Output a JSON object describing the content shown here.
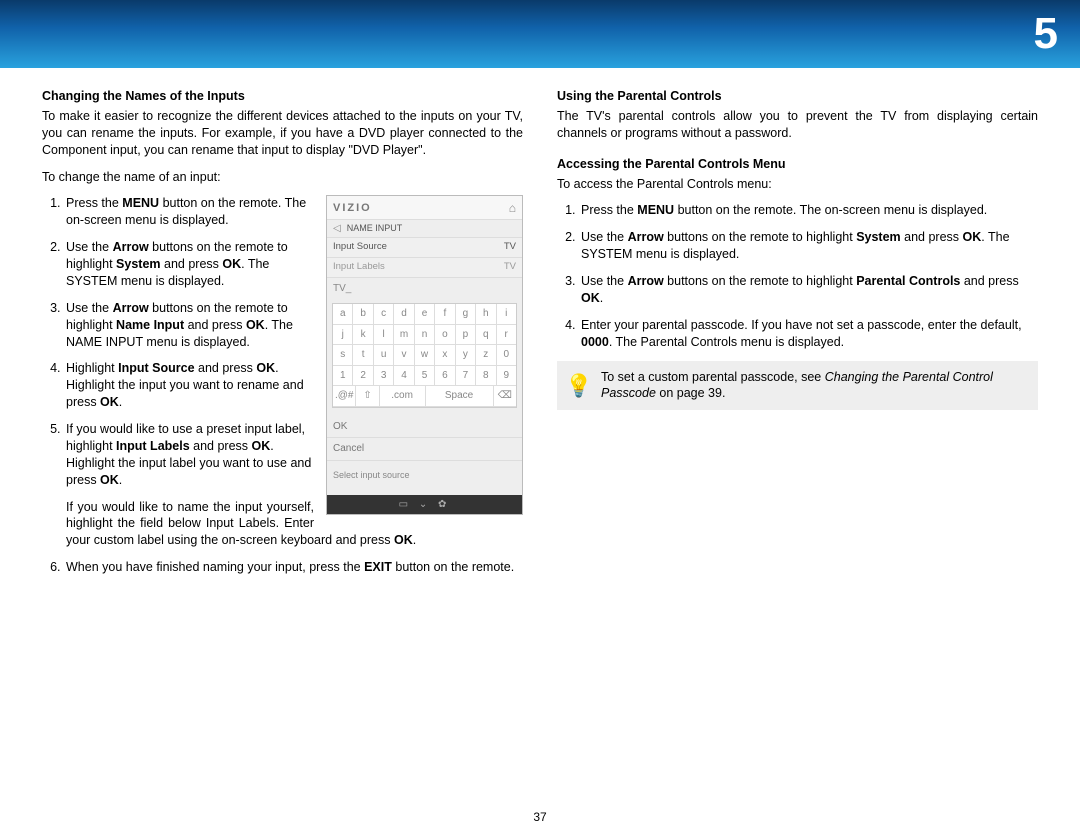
{
  "chapter": "5",
  "page_number": "37",
  "left": {
    "title": "Changing the Names of the Inputs",
    "intro": "To make it easier to recognize the different devices attached to the inputs on your TV, you can rename the inputs. For example, if you have a DVD player connected to the Component input, you can rename that input to display \"DVD Player\".",
    "lead": "To change the name of an input:",
    "steps_html": [
      "Press the <b>MENU</b> button on the remote. The on-screen menu is displayed.",
      "Use the <b>Arrow</b> buttons on the remote to highlight <b>System</b> and press <b>OK</b>. The SYSTEM menu is displayed.",
      "Use the <b>Arrow</b> buttons on the remote to highlight <b>Name Input</b> and press <b>OK</b>. The NAME INPUT menu is displayed.",
      "Highlight <b>Input Source</b> and press <b>OK</b>. Highlight the input you want to rename and press <b>OK</b>.",
      "If you would like to use a preset input label, highlight <b>Input Labels</b> and press <b>OK</b>. Highlight the input label you want to use and press <b>OK</b>.<div class=\"para justify\" style=\"margin:10px 0 0 0;\">If you would like to name the input yourself, highlight the field below Input Labels. Enter your custom label using the on-screen keyboard and press <b>OK</b>.</div>",
      "When you have finished naming your input, press the <b>EXIT</b> button on the remote."
    ],
    "osd": {
      "brand": "VIZIO",
      "subtitle": "NAME INPUT",
      "rows": [
        {
          "label": "Input Source",
          "value": "TV"
        },
        {
          "label": "Input Labels",
          "value": "TV"
        }
      ],
      "field_value": "TV_",
      "kbd_rows": [
        [
          "a",
          "b",
          "c",
          "d",
          "e",
          "f",
          "g",
          "h",
          "i"
        ],
        [
          "j",
          "k",
          "l",
          "m",
          "n",
          "o",
          "p",
          "q",
          "r"
        ],
        [
          "s",
          "t",
          "u",
          "v",
          "w",
          "x",
          "y",
          "z",
          "0"
        ],
        [
          "1",
          "2",
          "3",
          "4",
          "5",
          "6",
          "7",
          "8",
          "9"
        ]
      ],
      "kbd_bottom": [
        ".@#",
        "⇧",
        ".com",
        "Space",
        "⌫"
      ],
      "actions": [
        "OK",
        "Cancel"
      ],
      "hint": "Select input source",
      "footer_icons": "▭  ⌄  ✿"
    }
  },
  "right": {
    "title1": "Using the Parental Controls",
    "para1": "The TV's parental controls allow you to prevent the TV from displaying certain channels or programs without a password.",
    "title2": "Accessing the Parental Controls Menu",
    "lead2": "To access the Parental Controls menu:",
    "steps_html": [
      "Press the <b>MENU</b> button on the remote. The on-screen menu is displayed.",
      "Use the <b>Arrow</b> buttons on the remote to highlight <b>System</b> and press <b>OK</b>. The SYSTEM menu is displayed.",
      "Use the <b>Arrow</b> buttons on the remote to highlight <b>Parental Controls</b> and press <b>OK</b>.",
      "Enter your parental passcode. If you have not set a passcode, enter the default, <b>0000</b>. The Parental Controls menu is displayed."
    ],
    "tip_lead": "To set a custom parental passcode, see ",
    "tip_em": "Changing the Parental Control Passcode",
    "tip_tail": " on page 39."
  }
}
